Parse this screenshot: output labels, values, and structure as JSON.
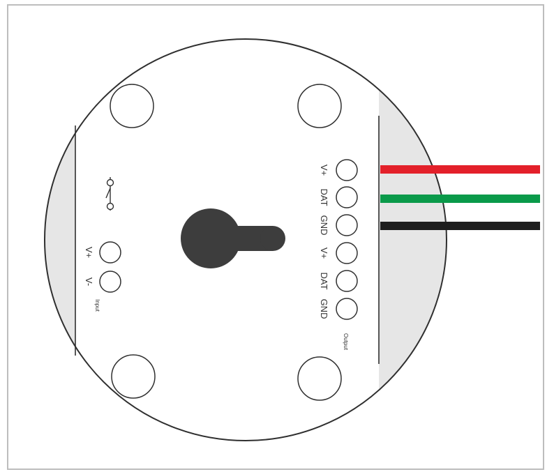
{
  "colors": {
    "board": "#ffffff",
    "outline": "#2f2f2f",
    "side_pad": "#e6e6e6",
    "keyhole": "#3d3d3d",
    "wire_vplus": "#e3202a",
    "wire_dat": "#0a9a4a",
    "wire_gnd": "#1e1e1e",
    "frame": "#bdbdbd"
  },
  "output_pins": [
    "V+",
    "DAT",
    "GND",
    "V+",
    "DAT",
    "GND"
  ],
  "output_caption": "Output",
  "input_pins": [
    "V+",
    "V-"
  ],
  "input_caption": "Input",
  "wires": [
    {
      "signal": "V+",
      "color": "#e3202a"
    },
    {
      "signal": "DAT",
      "color": "#0a9a4a"
    },
    {
      "signal": "GND",
      "color": "#1e1e1e"
    }
  ],
  "icons": [
    "mounting-hole-icon",
    "keyhole-mount-icon",
    "switch-symbol-icon"
  ]
}
